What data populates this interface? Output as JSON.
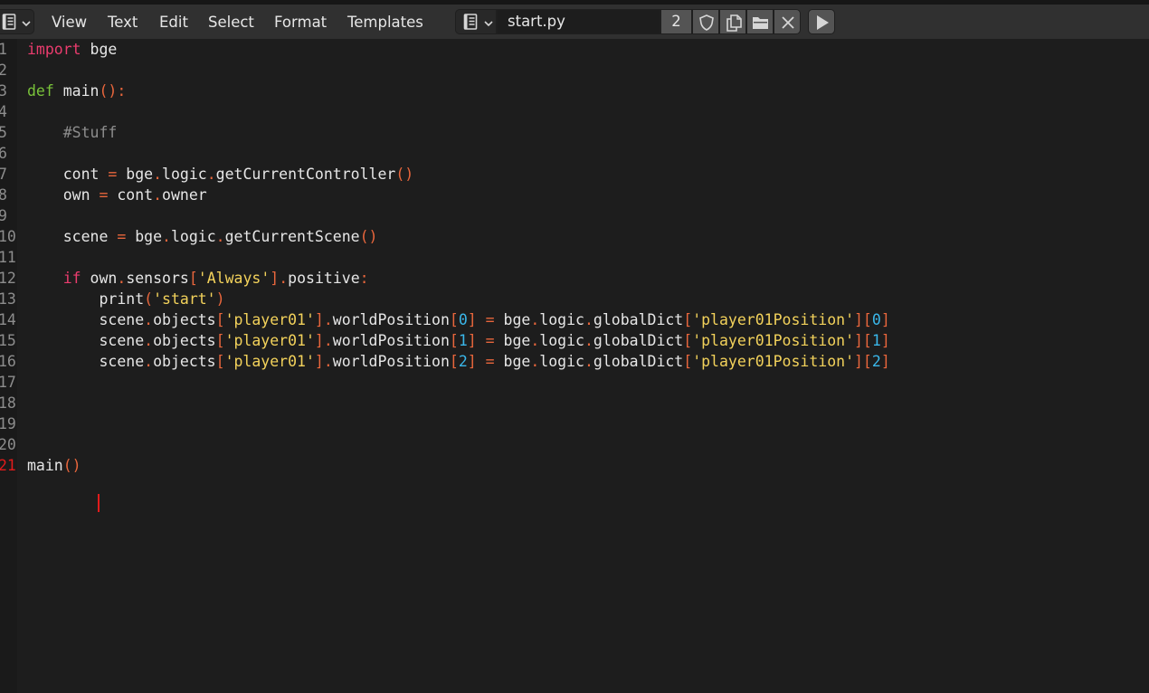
{
  "header": {
    "editor_type_icon": "text-editor-icon",
    "menu": {
      "view": "View",
      "text": "Text",
      "edit": "Edit",
      "select": "Select",
      "format": "Format",
      "templates": "Templates"
    },
    "textblock_icon": "text-document-icon",
    "filename": "start.py",
    "users_count": "2",
    "fake_user_icon": "shield-icon",
    "duplicate_icon": "duplicate-icon",
    "open_icon": "folder-open-icon",
    "unlink_icon": "close-icon",
    "run_icon": "play-icon"
  },
  "editor": {
    "current_line": 21,
    "lines": [
      {
        "num": "1",
        "tokens": [
          {
            "t": "keyword",
            "v": "import"
          },
          {
            "t": "plain",
            "v": " bge"
          }
        ]
      },
      {
        "num": "2",
        "tokens": []
      },
      {
        "num": "3",
        "tokens": [
          {
            "t": "def",
            "v": "def"
          },
          {
            "t": "plain",
            "v": " main"
          },
          {
            "t": "punct",
            "v": "():"
          }
        ]
      },
      {
        "num": "4",
        "tokens": []
      },
      {
        "num": "5",
        "tokens": [
          {
            "t": "plain",
            "v": "    "
          },
          {
            "t": "comment",
            "v": "#Stuff"
          }
        ]
      },
      {
        "num": "6",
        "tokens": []
      },
      {
        "num": "7",
        "tokens": [
          {
            "t": "plain",
            "v": "    cont "
          },
          {
            "t": "punct",
            "v": "="
          },
          {
            "t": "plain",
            "v": " bge"
          },
          {
            "t": "punct",
            "v": "."
          },
          {
            "t": "plain",
            "v": "logic"
          },
          {
            "t": "punct",
            "v": "."
          },
          {
            "t": "plain",
            "v": "getCurrentController"
          },
          {
            "t": "punct",
            "v": "()"
          }
        ]
      },
      {
        "num": "8",
        "tokens": [
          {
            "t": "plain",
            "v": "    own "
          },
          {
            "t": "punct",
            "v": "="
          },
          {
            "t": "plain",
            "v": " cont"
          },
          {
            "t": "punct",
            "v": "."
          },
          {
            "t": "plain",
            "v": "owner"
          }
        ]
      },
      {
        "num": "9",
        "tokens": []
      },
      {
        "num": "10",
        "tokens": [
          {
            "t": "plain",
            "v": "    scene "
          },
          {
            "t": "punct",
            "v": "="
          },
          {
            "t": "plain",
            "v": " bge"
          },
          {
            "t": "punct",
            "v": "."
          },
          {
            "t": "plain",
            "v": "logic"
          },
          {
            "t": "punct",
            "v": "."
          },
          {
            "t": "plain",
            "v": "getCurrentScene"
          },
          {
            "t": "punct",
            "v": "()"
          }
        ]
      },
      {
        "num": "11",
        "tokens": []
      },
      {
        "num": "12",
        "tokens": [
          {
            "t": "plain",
            "v": "    "
          },
          {
            "t": "keyword",
            "v": "if"
          },
          {
            "t": "plain",
            "v": " own"
          },
          {
            "t": "punct",
            "v": "."
          },
          {
            "t": "plain",
            "v": "sensors"
          },
          {
            "t": "punct",
            "v": "["
          },
          {
            "t": "string",
            "v": "'Always'"
          },
          {
            "t": "punct",
            "v": "]."
          },
          {
            "t": "plain",
            "v": "positive"
          },
          {
            "t": "punct",
            "v": ":"
          }
        ]
      },
      {
        "num": "13",
        "tokens": [
          {
            "t": "plain",
            "v": "        print"
          },
          {
            "t": "punct",
            "v": "("
          },
          {
            "t": "string",
            "v": "'start'"
          },
          {
            "t": "punct",
            "v": ")"
          }
        ]
      },
      {
        "num": "14",
        "tokens": [
          {
            "t": "plain",
            "v": "        scene"
          },
          {
            "t": "punct",
            "v": "."
          },
          {
            "t": "plain",
            "v": "objects"
          },
          {
            "t": "punct",
            "v": "["
          },
          {
            "t": "string",
            "v": "'player01'"
          },
          {
            "t": "punct",
            "v": "]."
          },
          {
            "t": "plain",
            "v": "worldPosition"
          },
          {
            "t": "punct",
            "v": "["
          },
          {
            "t": "number",
            "v": "0"
          },
          {
            "t": "punct",
            "v": "]"
          },
          {
            "t": "plain",
            "v": " "
          },
          {
            "t": "punct",
            "v": "="
          },
          {
            "t": "plain",
            "v": " bge"
          },
          {
            "t": "punct",
            "v": "."
          },
          {
            "t": "plain",
            "v": "logic"
          },
          {
            "t": "punct",
            "v": "."
          },
          {
            "t": "plain",
            "v": "globalDict"
          },
          {
            "t": "punct",
            "v": "["
          },
          {
            "t": "string",
            "v": "'player01Position'"
          },
          {
            "t": "punct",
            "v": "]["
          },
          {
            "t": "number",
            "v": "0"
          },
          {
            "t": "punct",
            "v": "]"
          }
        ]
      },
      {
        "num": "15",
        "tokens": [
          {
            "t": "plain",
            "v": "        scene"
          },
          {
            "t": "punct",
            "v": "."
          },
          {
            "t": "plain",
            "v": "objects"
          },
          {
            "t": "punct",
            "v": "["
          },
          {
            "t": "string",
            "v": "'player01'"
          },
          {
            "t": "punct",
            "v": "]."
          },
          {
            "t": "plain",
            "v": "worldPosition"
          },
          {
            "t": "punct",
            "v": "["
          },
          {
            "t": "number",
            "v": "1"
          },
          {
            "t": "punct",
            "v": "]"
          },
          {
            "t": "plain",
            "v": " "
          },
          {
            "t": "punct",
            "v": "="
          },
          {
            "t": "plain",
            "v": " bge"
          },
          {
            "t": "punct",
            "v": "."
          },
          {
            "t": "plain",
            "v": "logic"
          },
          {
            "t": "punct",
            "v": "."
          },
          {
            "t": "plain",
            "v": "globalDict"
          },
          {
            "t": "punct",
            "v": "["
          },
          {
            "t": "string",
            "v": "'player01Position'"
          },
          {
            "t": "punct",
            "v": "]["
          },
          {
            "t": "number",
            "v": "1"
          },
          {
            "t": "punct",
            "v": "]"
          }
        ]
      },
      {
        "num": "16",
        "tokens": [
          {
            "t": "plain",
            "v": "        scene"
          },
          {
            "t": "punct",
            "v": "."
          },
          {
            "t": "plain",
            "v": "objects"
          },
          {
            "t": "punct",
            "v": "["
          },
          {
            "t": "string",
            "v": "'player01'"
          },
          {
            "t": "punct",
            "v": "]."
          },
          {
            "t": "plain",
            "v": "worldPosition"
          },
          {
            "t": "punct",
            "v": "["
          },
          {
            "t": "number",
            "v": "2"
          },
          {
            "t": "punct",
            "v": "]"
          },
          {
            "t": "plain",
            "v": " "
          },
          {
            "t": "punct",
            "v": "="
          },
          {
            "t": "plain",
            "v": " bge"
          },
          {
            "t": "punct",
            "v": "."
          },
          {
            "t": "plain",
            "v": "logic"
          },
          {
            "t": "punct",
            "v": "."
          },
          {
            "t": "plain",
            "v": "globalDict"
          },
          {
            "t": "punct",
            "v": "["
          },
          {
            "t": "string",
            "v": "'player01Position'"
          },
          {
            "t": "punct",
            "v": "]["
          },
          {
            "t": "number",
            "v": "2"
          },
          {
            "t": "punct",
            "v": "]"
          }
        ]
      },
      {
        "num": "17",
        "tokens": []
      },
      {
        "num": "18",
        "tokens": []
      },
      {
        "num": "19",
        "tokens": []
      },
      {
        "num": "20",
        "tokens": []
      },
      {
        "num": "21",
        "tokens": [
          {
            "t": "plain",
            "v": "main"
          },
          {
            "t": "punct",
            "v": "()"
          }
        ]
      }
    ]
  }
}
